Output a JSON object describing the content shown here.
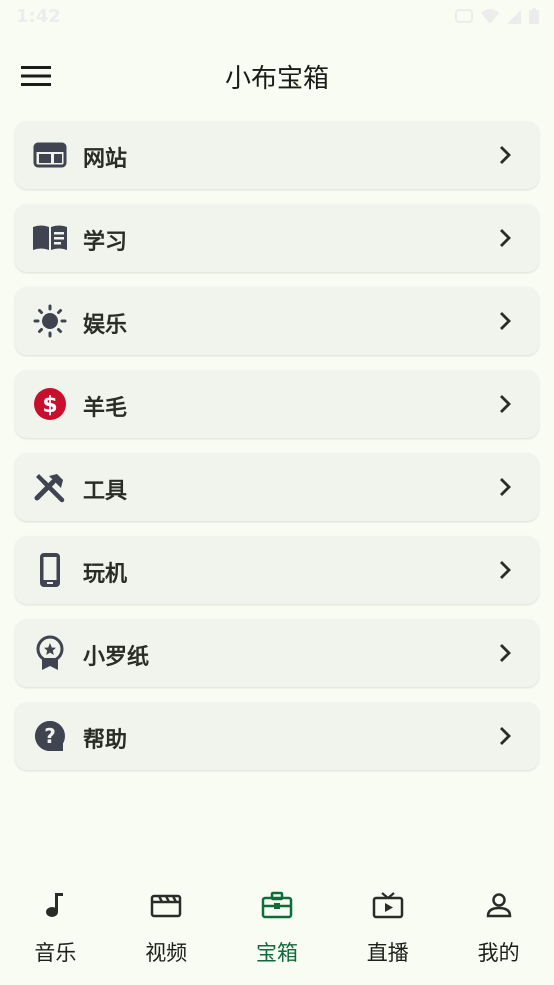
{
  "app": {
    "title": "小布宝箱"
  },
  "status_bar": {
    "time": "1:42"
  },
  "menu": [
    {
      "label": "网站",
      "icon": "web-icon"
    },
    {
      "label": "学习",
      "icon": "book-icon"
    },
    {
      "label": "娱乐",
      "icon": "sun-icon"
    },
    {
      "label": "羊毛",
      "icon": "dollar-icon"
    },
    {
      "label": "工具",
      "icon": "tools-icon"
    },
    {
      "label": "玩机",
      "icon": "phone-icon"
    },
    {
      "label": "小罗纸",
      "icon": "badge-icon"
    },
    {
      "label": "帮助",
      "icon": "help-icon"
    }
  ],
  "bottom_nav": [
    {
      "label": "音乐",
      "icon": "music-note-icon",
      "active": false
    },
    {
      "label": "视频",
      "icon": "clapperboard-icon",
      "active": false
    },
    {
      "label": "宝箱",
      "icon": "briefcase-icon",
      "active": true
    },
    {
      "label": "直播",
      "icon": "tv-icon",
      "active": false
    },
    {
      "label": "我的",
      "icon": "person-icon",
      "active": false
    }
  ],
  "colors": {
    "background": "#f9fcf3",
    "card": "#f1f4ed",
    "icon": "#3f4450",
    "accent": "#0e6b3b",
    "dollar": "#c8102e"
  }
}
